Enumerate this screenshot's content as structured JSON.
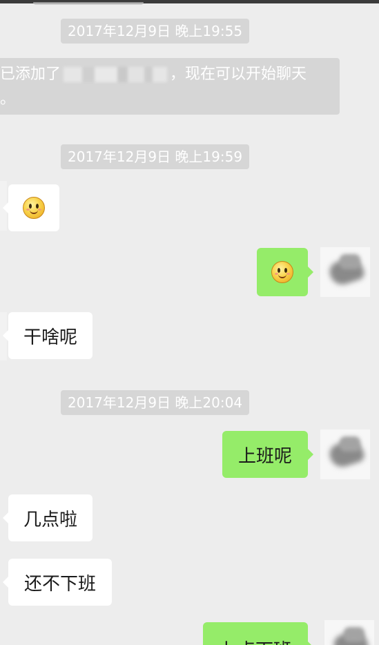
{
  "status_bar": {},
  "timestamps": [
    "2017年12月9日 晚上19:55",
    "2017年12月9日 晚上19:59",
    "2017年12月9日 晚上20:04"
  ],
  "system_message": {
    "prefix": "已添加了",
    "suffix": "，现在可以开始聊天",
    "line2": "。"
  },
  "messages": [
    {
      "side": "in",
      "type": "emoji",
      "emoji": "smiley-icon"
    },
    {
      "side": "out",
      "type": "emoji",
      "emoji": "smiley-icon"
    },
    {
      "side": "in",
      "type": "text",
      "text": "干啥呢"
    },
    {
      "side": "out",
      "type": "text",
      "text": "上班呢"
    },
    {
      "side": "in",
      "type": "text",
      "text": "几点啦"
    },
    {
      "side": "in",
      "type": "text",
      "text": "还不下班"
    },
    {
      "side": "out",
      "type": "text",
      "text": "七点下班"
    }
  ],
  "colors": {
    "background": "#ededed",
    "incoming_bubble": "#ffffff",
    "outgoing_bubble": "#95ec69",
    "timestamp_bg": "#d6d6d6"
  }
}
